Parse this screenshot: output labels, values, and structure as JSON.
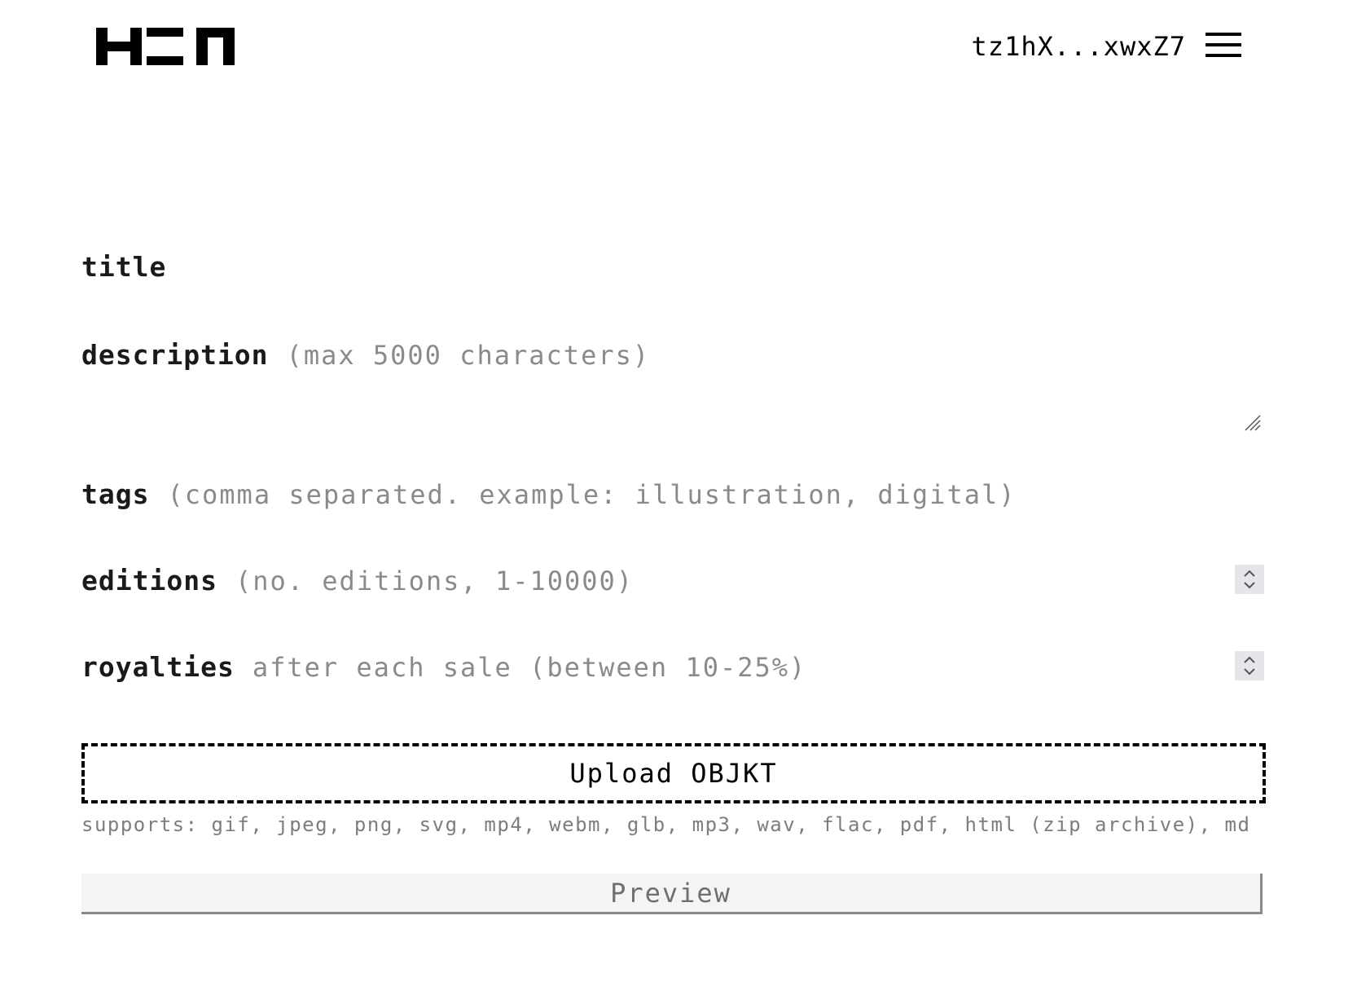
{
  "header": {
    "logo_icon": "hen-logo-icon",
    "wallet_address": "tz1hX...xwxZ7",
    "menu_icon": "hamburger-menu-icon"
  },
  "form": {
    "title": {
      "label": "title",
      "hint": ""
    },
    "description": {
      "label": "description",
      "hint": "(max 5000 characters)"
    },
    "tags": {
      "label": "tags",
      "hint": "(comma separated. example: illustration, digital)"
    },
    "editions": {
      "label": "editions",
      "hint": "(no. editions, 1-10000)"
    },
    "royalties": {
      "label": "royalties",
      "hint": "after each sale (between 10-25%)"
    },
    "upload": {
      "label": "Upload OBJKT",
      "supports": "supports: gif, jpeg, png, svg, mp4, webm, glb, mp3, wav, flac, pdf, html (zip archive), md"
    },
    "preview_label": "Preview"
  }
}
